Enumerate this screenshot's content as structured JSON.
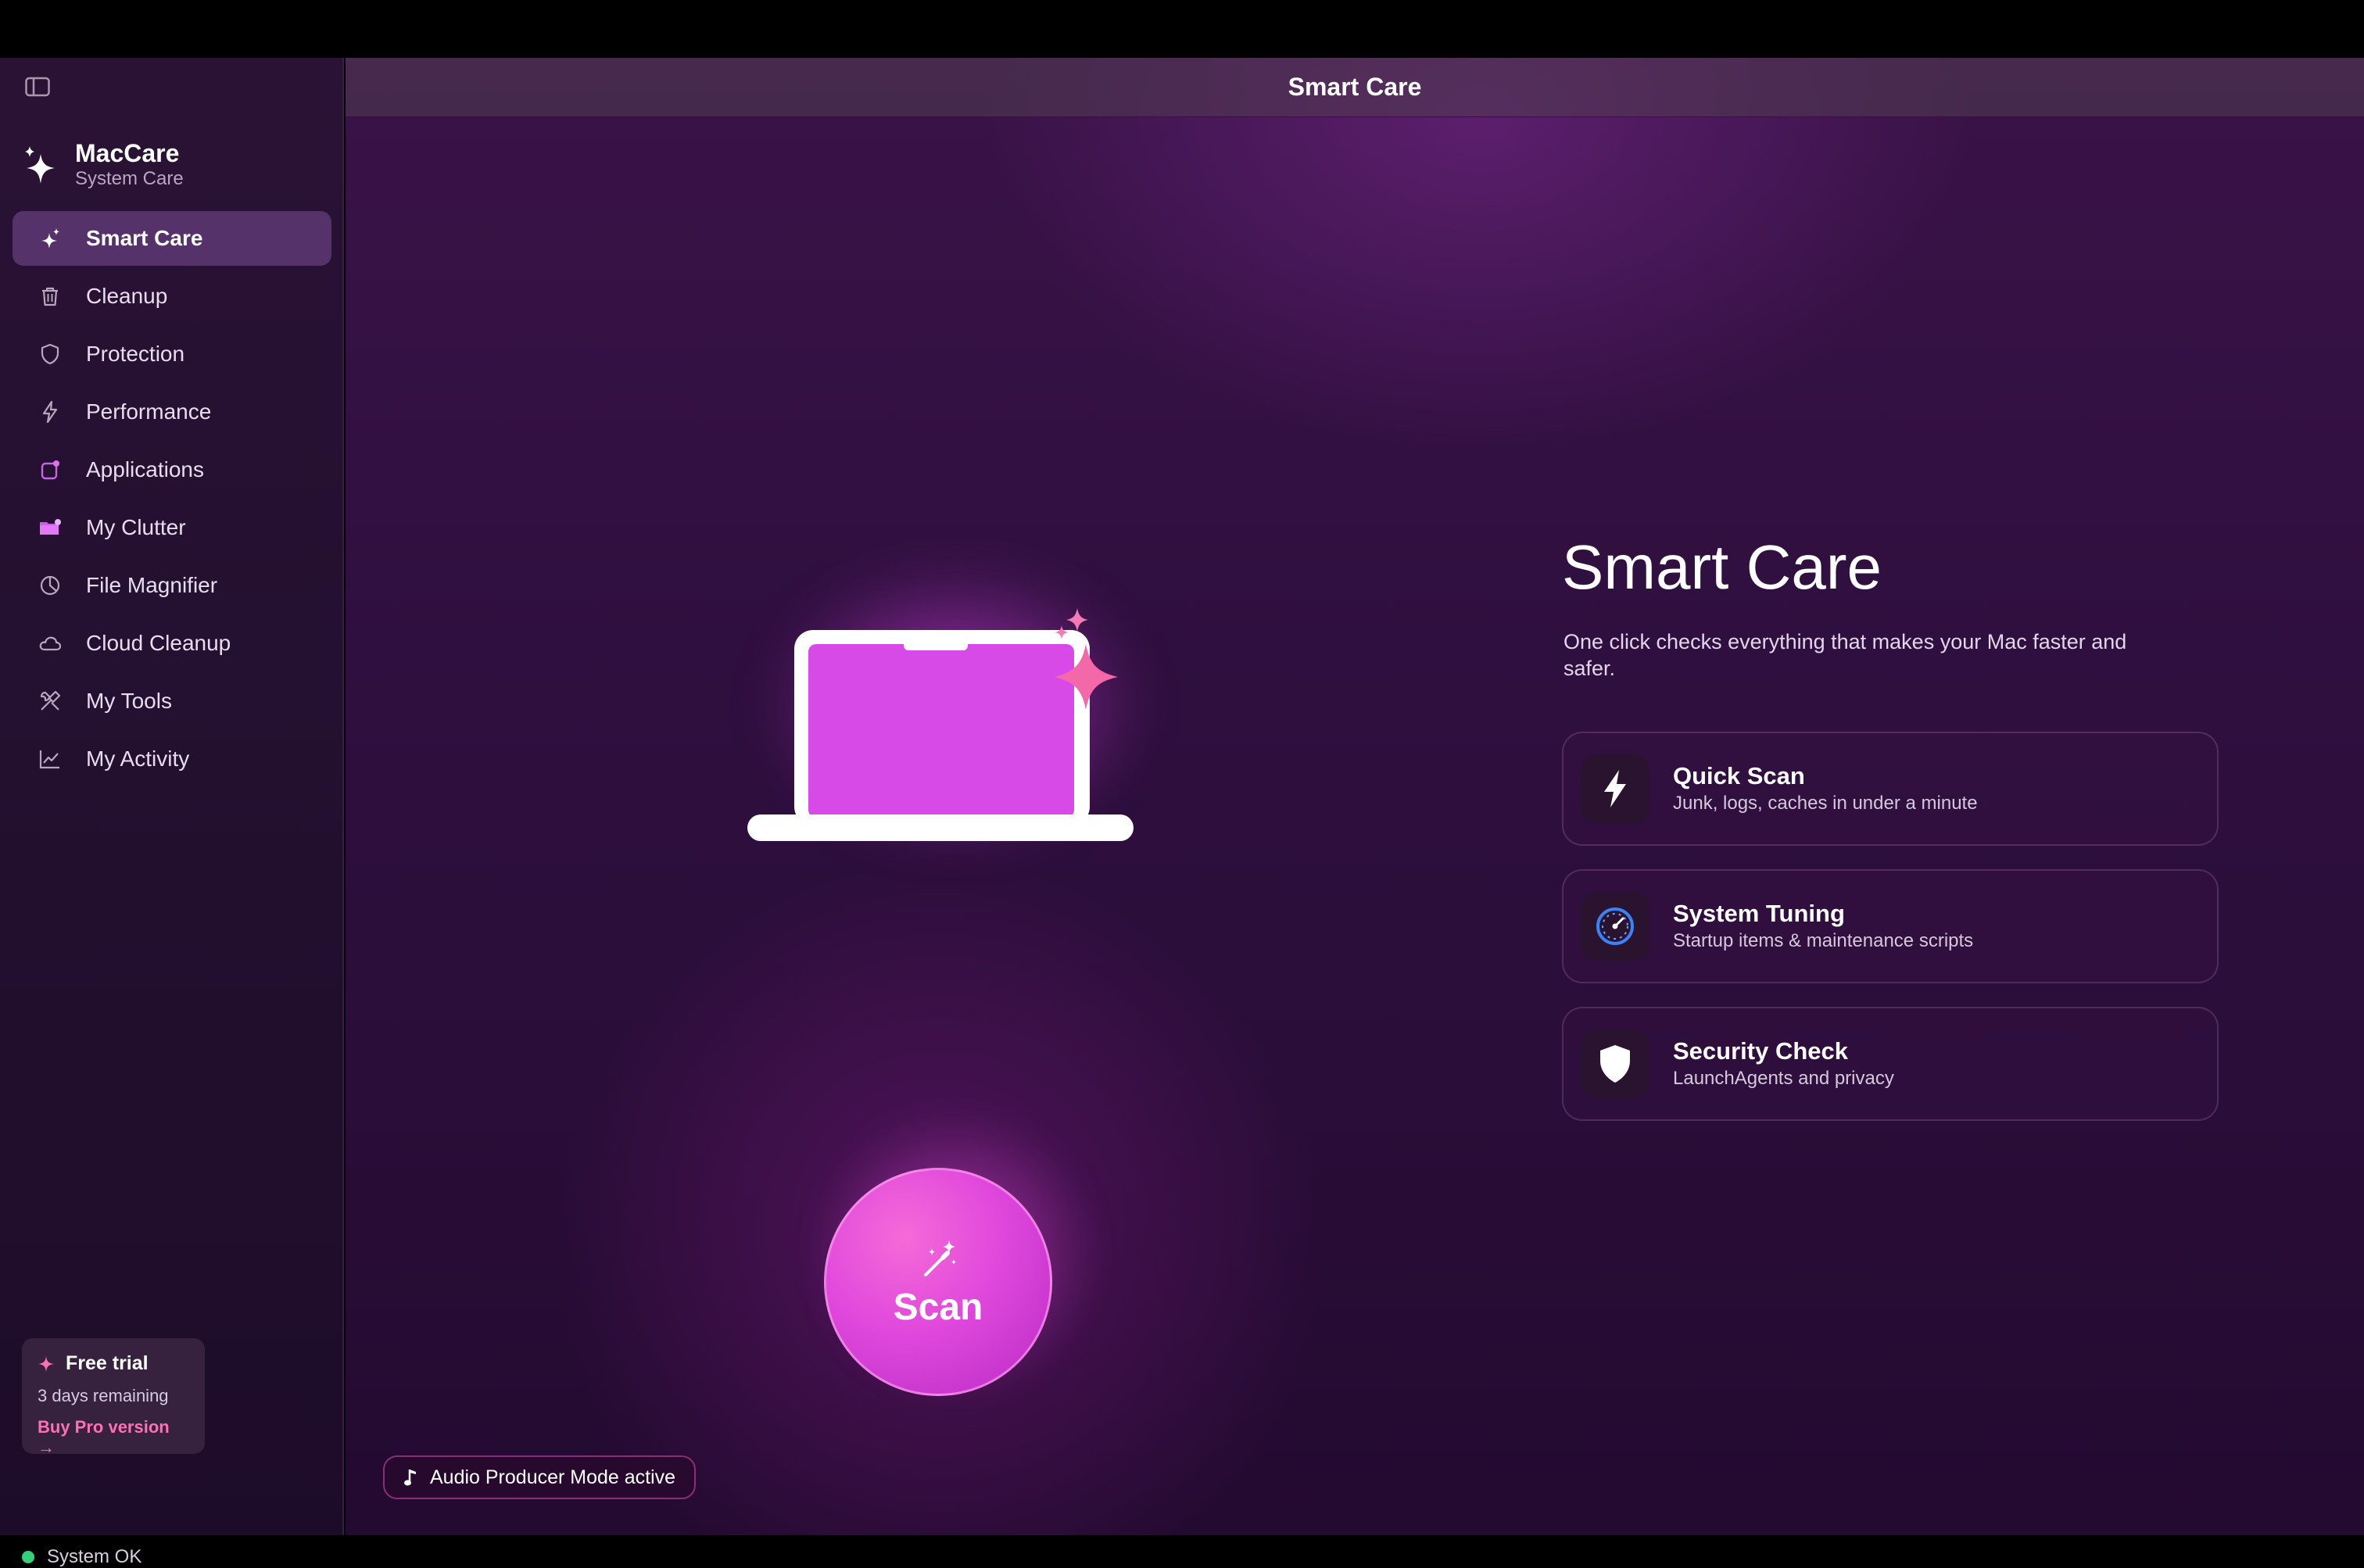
{
  "window": {
    "title": "Smart Care"
  },
  "brand": {
    "name": "MacCare",
    "subtitle": "System Care"
  },
  "sidebar": {
    "items": [
      {
        "label": "Smart Care",
        "icon": "sparkle-icon",
        "active": true
      },
      {
        "label": "Cleanup",
        "icon": "trash-icon",
        "active": false
      },
      {
        "label": "Protection",
        "icon": "shield-icon",
        "active": false
      },
      {
        "label": "Performance",
        "icon": "bolt-icon",
        "active": false
      },
      {
        "label": "Applications",
        "icon": "app-icon",
        "active": false
      },
      {
        "label": "My Clutter",
        "icon": "folder-icon",
        "active": false
      },
      {
        "label": "File Magnifier",
        "icon": "pie-chart-icon",
        "active": false
      },
      {
        "label": "Cloud Cleanup",
        "icon": "cloud-icon",
        "active": false
      },
      {
        "label": "My Tools",
        "icon": "tools-icon",
        "active": false
      },
      {
        "label": "My Activity",
        "icon": "activity-chart-icon",
        "active": false
      }
    ],
    "trial": {
      "title": "Free trial",
      "remaining": "3 days remaining",
      "buy_label": "Buy Pro version →"
    },
    "status": "System OK"
  },
  "main": {
    "header_title": "Smart Care",
    "hero_title": "Smart Care",
    "hero_description": "One click checks everything that makes your Mac faster and safer.",
    "features": [
      {
        "title": "Quick Scan",
        "subtitle": "Junk, logs, caches in under a minute",
        "icon": "bolt-icon"
      },
      {
        "title": "System Tuning",
        "subtitle": "Startup items & maintenance scripts",
        "icon": "gauge-icon"
      },
      {
        "title": "Security Check",
        "subtitle": "LaunchAgents and privacy",
        "icon": "shield-icon"
      }
    ],
    "scan_label": "Scan",
    "mode_pill": "Audio Producer Mode active"
  },
  "colors": {
    "accent": "#e048dc",
    "link": "#ff6fb8",
    "status_ok": "#33d17a",
    "sidebar_active": "#55336a"
  }
}
